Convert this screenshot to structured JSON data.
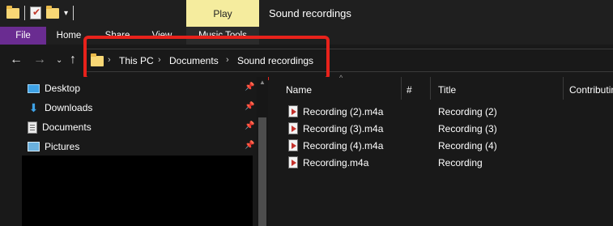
{
  "window": {
    "title": "Sound recordings",
    "context_tab": "Play",
    "qat_arrow": "▾"
  },
  "ribbon": {
    "tabs": [
      "File",
      "Home",
      "Share",
      "View",
      "Music Tools"
    ]
  },
  "nav_buttons": {
    "back": "←",
    "forward": "→",
    "recent": "⌄",
    "up": "↑"
  },
  "address": {
    "chevron": "›",
    "crumbs": [
      "This PC",
      "Documents",
      "Sound recordings"
    ]
  },
  "nav_pane": {
    "pin_glyph": "📌",
    "items": [
      {
        "label": "Desktop",
        "icon": "desktop-icon"
      },
      {
        "label": "Downloads",
        "icon": "downloads-icon"
      },
      {
        "label": "Documents",
        "icon": "documents-icon"
      },
      {
        "label": "Pictures",
        "icon": "pictures-icon"
      }
    ],
    "scroll_up": "▲"
  },
  "file_list": {
    "sort_indicator": "^",
    "columns": [
      "Name",
      "#",
      "Title",
      "Contributing artists"
    ],
    "rows": [
      {
        "name": "Recording (2).m4a",
        "title": "Recording (2)"
      },
      {
        "name": "Recording (3).m4a",
        "title": "Recording (3)"
      },
      {
        "name": "Recording (4).m4a",
        "title": "Recording (4)"
      },
      {
        "name": "Recording.m4a",
        "title": "Recording"
      }
    ]
  },
  "colors": {
    "file_tab": "#6a2c91",
    "play_tab": "#f5ec9e",
    "highlight": "#e8221b",
    "background": "#191919"
  }
}
